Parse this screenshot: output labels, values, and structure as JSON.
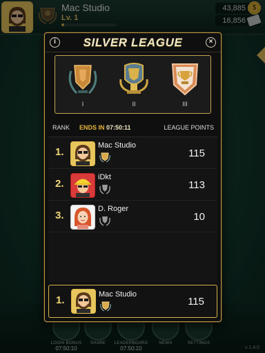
{
  "header": {
    "player_name": "Mac Studio",
    "level": "Lv. 1",
    "xp_progress": 0.05,
    "coins": "43,885",
    "cash": "16,856"
  },
  "modal": {
    "title": "SILVER LEAGUE",
    "tiers": [
      {
        "label": "I",
        "color": "#c9893a"
      },
      {
        "label": "II",
        "color": "#d8b24a"
      },
      {
        "label": "III",
        "color": "#d98a55"
      }
    ],
    "columns": {
      "rank": "RANK",
      "ends_in_label": "ENDS IN",
      "ends_in_time": "07:50:11",
      "league_points": "LEAGUE POINTS"
    },
    "players": [
      {
        "rank": "1.",
        "name": "Mac Studio",
        "points": "115",
        "avatar": "bearded-man-avatar",
        "trophy": "gold-trophy-icon"
      },
      {
        "rank": "2.",
        "name": "iDkt",
        "points": "113",
        "avatar": "hardhat-man-avatar",
        "trophy": "silver-wreath-icon"
      },
      {
        "rank": "3.",
        "name": "D. Roger",
        "points": "10",
        "avatar": "redhead-woman-avatar",
        "trophy": "silver-wreath-icon"
      }
    ],
    "you": {
      "rank": "1.",
      "name": "Mac Studio",
      "points": "115"
    }
  },
  "bottom_nav": [
    {
      "label": "LOGIN BONUS",
      "timer": "07:50:10"
    },
    {
      "label": "SHARE",
      "timer": ""
    },
    {
      "label": "LEADERBOARD",
      "timer": "07:50:10"
    },
    {
      "label": "NEWS",
      "timer": ""
    },
    {
      "label": "SETTINGS",
      "timer": ""
    }
  ],
  "version": "v 1.4.0",
  "colors": {
    "accent_gold": "#d8b54c",
    "table_green": "#143a2e",
    "timer_orange": "#e8b43c"
  }
}
